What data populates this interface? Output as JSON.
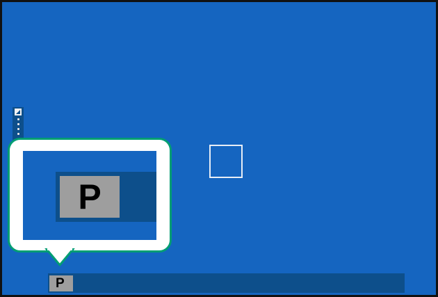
{
  "desktop": {
    "background_color": "#1565c0",
    "side_toolbar": {
      "icons": [
        "image-icon",
        "dot-icon",
        "dot-icon",
        "dot-icon",
        "dot-icon"
      ]
    }
  },
  "taskbar": {
    "app_button_label": "P",
    "app_button_color": "#9e9e9e",
    "bar_color": "#0d4f8b"
  },
  "callout": {
    "border_color": "#009e73",
    "zoomed_label": "P"
  }
}
